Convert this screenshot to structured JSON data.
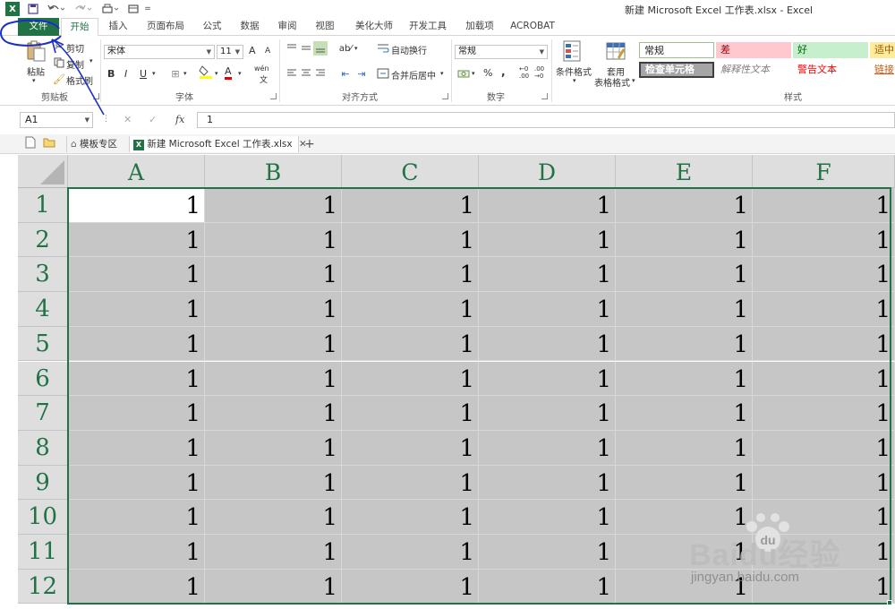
{
  "app": {
    "window_title": "新建 Microsoft Excel 工作表.xlsx - Excel"
  },
  "quick_access": {
    "excel_icon": "X",
    "items": [
      "save-icon",
      "undo-icon",
      "redo-icon",
      "print-icon",
      "view-icon"
    ]
  },
  "tabs": [
    {
      "label": "文件"
    },
    {
      "label": "开始"
    },
    {
      "label": "插入"
    },
    {
      "label": "页面布局"
    },
    {
      "label": "公式"
    },
    {
      "label": "数据"
    },
    {
      "label": "审阅"
    },
    {
      "label": "视图"
    },
    {
      "label": "美化大师"
    },
    {
      "label": "开发工具"
    },
    {
      "label": "加载项"
    },
    {
      "label": "ACROBAT"
    }
  ],
  "ribbon": {
    "clipboard": {
      "paste": "粘贴",
      "cut": "剪切",
      "copy": "复制",
      "format_painter": "格式刷",
      "label": "剪贴板"
    },
    "font": {
      "name": "宋体",
      "size": "11",
      "bold": "B",
      "italic": "I",
      "underline": "U",
      "grow": "A",
      "shrink": "A",
      "font_color": "A",
      "wen": "wén",
      "label": "字体"
    },
    "alignment": {
      "wrap": "自动换行",
      "merge": "合并后居中",
      "label": "对齐方式"
    },
    "number": {
      "format": "常规",
      "percent": "%",
      "comma": ",",
      "inc": "←0 .00",
      "dec": ".00 →0",
      "label": "数字"
    },
    "styles": {
      "conditional": "条件格式",
      "table_line1": "套用",
      "table_line2": "表格格式",
      "normal": "常规",
      "bad": "差",
      "good": "好",
      "neutral": "适中",
      "check_cell": "检查单元格",
      "explanatory": "解释性文本",
      "warning": "警告文本",
      "link": "链接",
      "label": "样式"
    }
  },
  "formula_bar": {
    "name_box": "A1",
    "cancel": "✕",
    "enter": "✓",
    "fx": "fx",
    "value": "1"
  },
  "doc_tabs": {
    "template": "模板专区",
    "file": "新建 Microsoft Excel 工作表.xlsx",
    "close": "✕",
    "add": "+"
  },
  "grid": {
    "columns": [
      "A",
      "B",
      "C",
      "D",
      "E",
      "F"
    ],
    "rows": [
      "1",
      "2",
      "3",
      "4",
      "5",
      "6",
      "7",
      "8",
      "9",
      "10",
      "11",
      "12"
    ],
    "cells": [
      [
        "1",
        "1",
        "1",
        "1",
        "1",
        "1"
      ],
      [
        "1",
        "1",
        "1",
        "1",
        "1",
        "1"
      ],
      [
        "1",
        "1",
        "1",
        "1",
        "1",
        "1"
      ],
      [
        "1",
        "1",
        "1",
        "1",
        "1",
        "1"
      ],
      [
        "1",
        "1",
        "1",
        "1",
        "1",
        "1"
      ],
      [
        "1",
        "1",
        "1",
        "1",
        "1",
        "1"
      ],
      [
        "1",
        "1",
        "1",
        "1",
        "1",
        "1"
      ],
      [
        "1",
        "1",
        "1",
        "1",
        "1",
        "1"
      ],
      [
        "1",
        "1",
        "1",
        "1",
        "1",
        "1"
      ],
      [
        "1",
        "1",
        "1",
        "1",
        "1",
        "1"
      ],
      [
        "1",
        "1",
        "1",
        "1",
        "1",
        "1"
      ],
      [
        "1",
        "1",
        "1",
        "1",
        "1",
        "1"
      ]
    ],
    "active_cell": "A1"
  },
  "watermark": {
    "brand": "Baidu经验",
    "url": "jingyan.baidu.com"
  },
  "colors": {
    "excel_green": "#217346",
    "annotation_blue": "#1a2fc9",
    "selection_gray": "#c6c6c6"
  }
}
